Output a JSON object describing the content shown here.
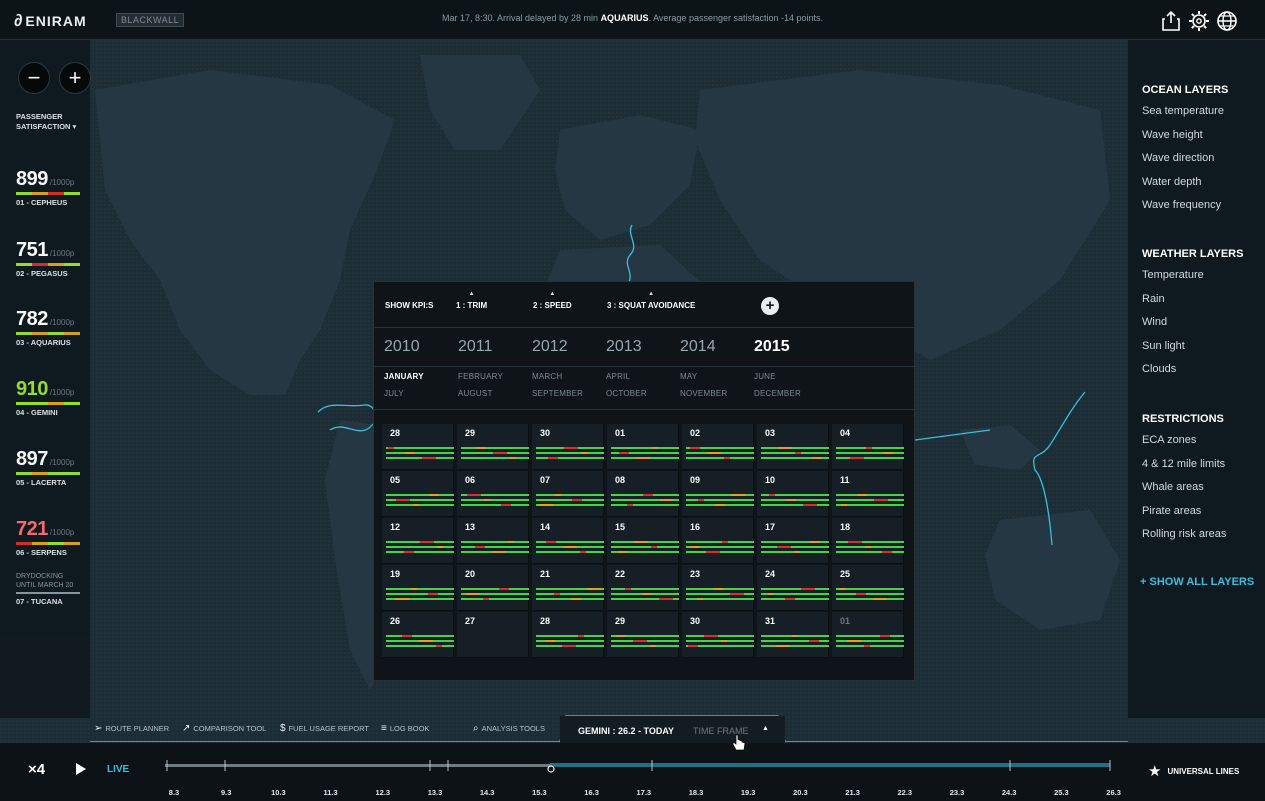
{
  "header": {
    "logo_text": "ENIRAM",
    "brand_badge": "BLACKWALL",
    "alert_prefix": "Mar 17, 8:30. Arrival delayed by 28 min ",
    "alert_ship": "AQUARIUS",
    "alert_suffix": ". Average passenger satisfaction -14 points.",
    "icons": [
      "share-icon",
      "gear-icon",
      "globe-icon"
    ]
  },
  "left_rail": {
    "zoom_out": "−",
    "zoom_in": "+",
    "heading_line1": "PASSENGER",
    "heading_line2": "SATISFACTION ▾",
    "unit": "/1000p",
    "ships": [
      {
        "score": "899",
        "name": "01 - CEPHEUS",
        "score_color": "#ffffff"
      },
      {
        "score": "751",
        "name": "02 - PEGASUS",
        "score_color": "#ffffff"
      },
      {
        "score": "782",
        "name": "03 - AQUARIUS",
        "score_color": "#ffffff"
      },
      {
        "score": "910",
        "name": "04 - GEMINI",
        "score_color": "#9be22d"
      },
      {
        "score": "897",
        "name": "05 - LACERTA",
        "score_color": "#ffffff"
      },
      {
        "score": "721",
        "name": "06 - SERPENS",
        "score_color": "#ff6b6b"
      }
    ],
    "drydock_line1": "DRYDOCKING",
    "drydock_line2": "UNTIL MARCH 20",
    "drydock_ship": "07 - TUCANA"
  },
  "right_rail": {
    "ocean_title": "OCEAN LAYERS",
    "ocean_items": [
      "Sea temperature",
      "Wave height",
      "Wave direction",
      "Water depth",
      "Wave frequency"
    ],
    "weather_title": "WEATHER LAYERS",
    "weather_items": [
      "Temperature",
      "Rain",
      "Wind",
      "Sun light",
      "Clouds"
    ],
    "restrictions_title": "RESTRICTIONS",
    "restrictions_items": [
      "ECA zones",
      "4 & 12 mile limits",
      "Whale areas",
      "Pirate areas",
      "Rolling risk areas"
    ],
    "show_all": "+ SHOW ALL LAYERS"
  },
  "calendar": {
    "show_kpis": "SHOW KPI:S",
    "kpi_arrow": "▲",
    "kpis": [
      "1 : TRIM",
      "2 : SPEED",
      "3 : SQUAT AVOIDANCE"
    ],
    "add": "+",
    "years": [
      "2010",
      "2011",
      "2012",
      "2013",
      "2014",
      "2015"
    ],
    "selected_year": "2015",
    "months_row1": [
      "JANUARY",
      "FEBRUARY",
      "MARCH",
      "APRIL",
      "MAY",
      "JUNE"
    ],
    "months_row2": [
      "JULY",
      "AUGUST",
      "SEPTEMBER",
      "OCTOBER",
      "NOVEMBER",
      "DECEMBER"
    ],
    "selected_month": "JANUARY",
    "days": [
      "28",
      "29",
      "30",
      "01",
      "02",
      "03",
      "04",
      "05",
      "06",
      "07",
      "08",
      "09",
      "10",
      "11",
      "12",
      "13",
      "14",
      "15",
      "16",
      "17",
      "18",
      "19",
      "20",
      "21",
      "22",
      "23",
      "24",
      "25",
      "26",
      "27",
      "28",
      "29",
      "30",
      "31",
      "01"
    ],
    "colors": {
      "good": "#47d24a",
      "warn": "#e0a21a",
      "bad": "#d7302a"
    }
  },
  "bottom_tools": [
    {
      "icon": "route-icon",
      "label": "ROUTE PLANNER"
    },
    {
      "icon": "comparison-icon",
      "label": "COMPARISON TOOL"
    },
    {
      "icon": "dollar-icon",
      "label": "FUEL USAGE REPORT"
    },
    {
      "icon": "book-icon",
      "label": "LOG BOOK"
    },
    {
      "icon": "search-icon",
      "label": "ANALYSIS TOOLS"
    }
  ],
  "active_tab": {
    "title": "GEMINI : 26.2 - TODAY",
    "subtitle": "TIME FRAME",
    "arrow": "▲"
  },
  "timeline": {
    "speed": "×4",
    "live": "LIVE",
    "ticks": [
      "8.3",
      "9.3",
      "10.3",
      "11.3",
      "12.3",
      "13.3",
      "14.3",
      "15.3",
      "16.3",
      "17.3",
      "18.3",
      "19.3",
      "20.3",
      "21.3",
      "22.3",
      "23.3",
      "24.3",
      "25.3",
      "26.3"
    ],
    "universal_lines": "UNIVERSAL LINES"
  },
  "accent": "#37c0e0"
}
